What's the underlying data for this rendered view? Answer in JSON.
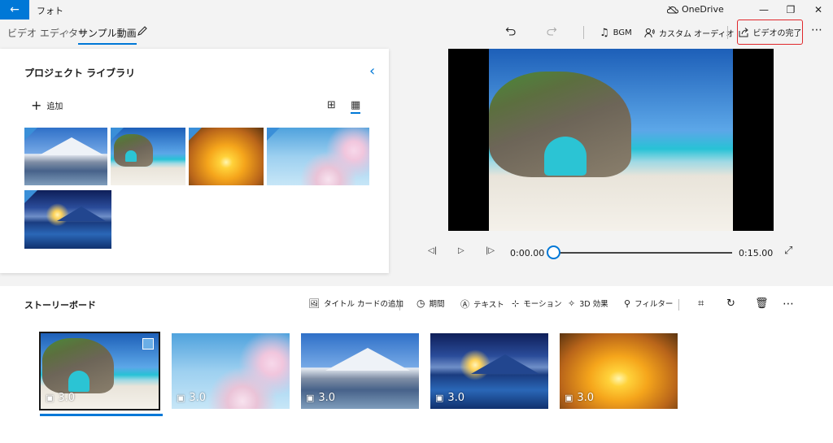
{
  "app": {
    "title": "フォト",
    "onedrive": "OneDrive"
  },
  "window_controls": {
    "minimize": "—",
    "restore": "❐",
    "close": "✕"
  },
  "breadcrumb": {
    "parent": "ビデオ エディター",
    "current": "サンプル動画"
  },
  "toolbar": {
    "bgm_label": "BGM",
    "custom_audio_label": "カスタム オーディオ",
    "finish_label": "ビデオの完了",
    "more_label": "⋯"
  },
  "library": {
    "title": "プロジェクト ライブラリ",
    "add_label": "追加"
  },
  "player": {
    "current_time": "0:00.00",
    "total_time": "0:15.00",
    "progress": 0
  },
  "storyboard": {
    "title": "ストーリーボード",
    "buttons": {
      "title_card": "タイトル カードの追加",
      "duration": "期間",
      "text": "テキスト",
      "motion": "モーション",
      "effects_3d": "3D 効果",
      "filter": "フィルター"
    },
    "clips": [
      {
        "duration": "3.0",
        "image": "beach-arch"
      },
      {
        "duration": "3.0",
        "image": "sakura"
      },
      {
        "duration": "3.0",
        "image": "mt-fuji"
      },
      {
        "duration": "3.0",
        "image": "fuji-sunrise-lake"
      },
      {
        "duration": "3.0",
        "image": "sunset-clouds"
      }
    ]
  },
  "colors": {
    "accent": "#0078d7",
    "highlight_border": "#e0272b"
  }
}
